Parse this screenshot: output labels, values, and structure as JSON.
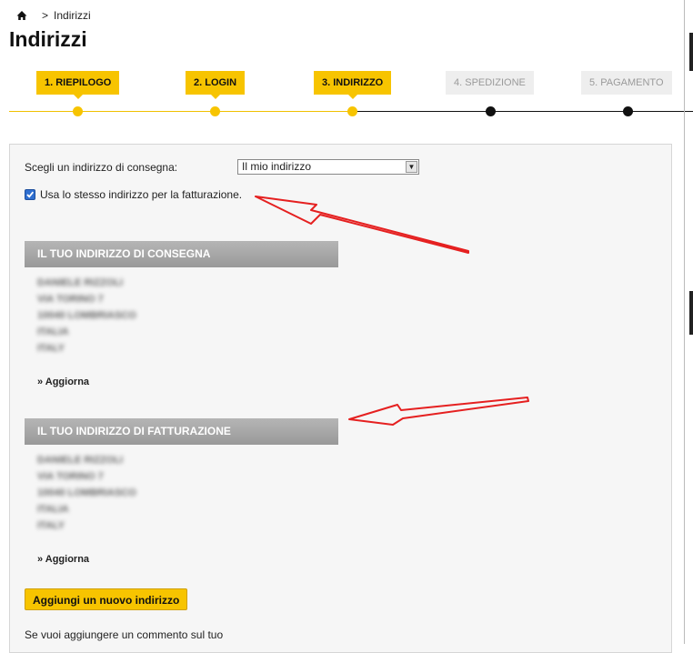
{
  "breadcrumb": {
    "separator": ">",
    "current": "Indirizzi"
  },
  "page_title": "Indirizzi",
  "steps": [
    {
      "label": "1. RIEPILOGO",
      "state": "done"
    },
    {
      "label": "2. LOGIN",
      "state": "done"
    },
    {
      "label": "3. INDIRIZZO",
      "state": "current"
    },
    {
      "label": "4. SPEDIZIONE",
      "state": "todo"
    },
    {
      "label": "5. PAGAMENTO",
      "state": "todo"
    }
  ],
  "form": {
    "choose_label": "Scegli un indirizzo di consegna:",
    "select_value": "Il mio indirizzo",
    "same_billing_label": "Usa lo stesso indirizzo per la fatturazione.",
    "same_billing_checked": true
  },
  "delivery": {
    "header": "IL TUO INDIRIZZO DI CONSEGNA",
    "lines": [
      "DANIELE RIZZOLI",
      "VIA TORINO 7",
      "10040 LOMBRIASCO",
      "ITALIA",
      "ITALY"
    ],
    "update_label": "» Aggiorna"
  },
  "billing": {
    "header": "IL TUO INDIRIZZO DI FATTURAZIONE",
    "lines": [
      "DANIELE RIZZOLI",
      "VIA TORINO 7",
      "10040 LOMBRIASCO",
      "ITALIA",
      "ITALY"
    ],
    "update_label": "» Aggiorna"
  },
  "add_address_button": "Aggiungi un nuovo indirizzo",
  "comment_text": "Se vuoi aggiungere un commento sul tuo",
  "colors": {
    "accent": "#f7c400",
    "annotation": "#e52020",
    "header_gray": "#a6a6a6"
  }
}
